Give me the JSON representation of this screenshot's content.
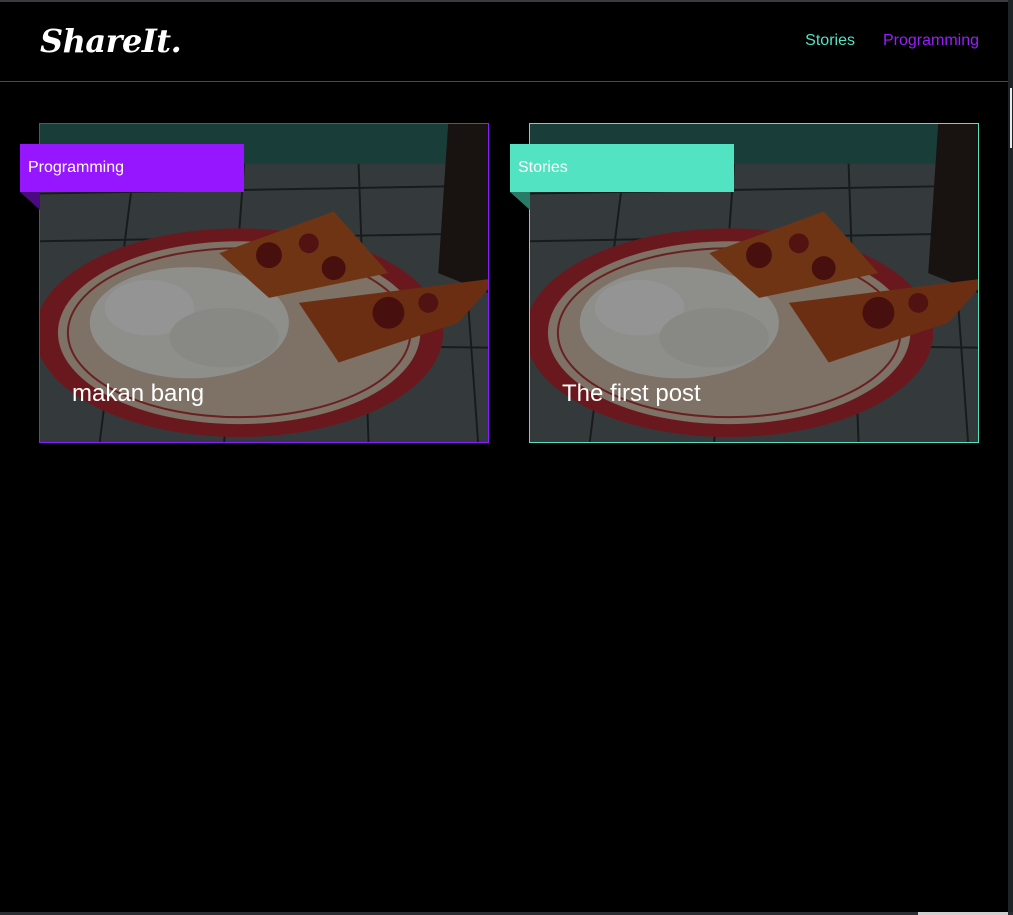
{
  "brand": {
    "logo": "ShareIt."
  },
  "nav": {
    "items": [
      {
        "label": "Stories",
        "color": "#52e3c3"
      },
      {
        "label": "Programming",
        "color": "#9b1dff"
      }
    ]
  },
  "posts": [
    {
      "category": "Programming",
      "title": "makan bang",
      "accent": "#9616ff",
      "image": "plate-of-rice-and-pizza"
    },
    {
      "category": "Stories",
      "title": "The first post",
      "accent": "#52e3c3",
      "image": "plate-of-rice-and-pizza"
    }
  ]
}
